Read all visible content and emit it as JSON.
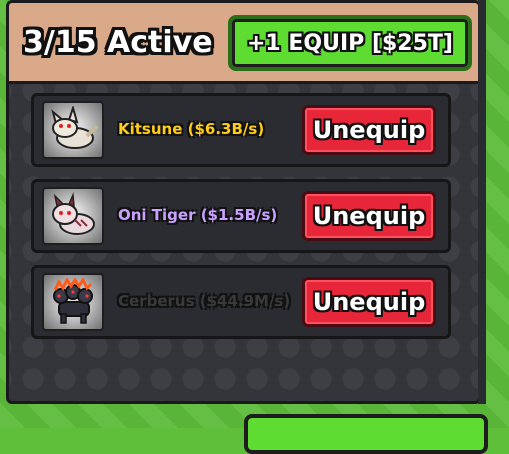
{
  "header": {
    "active_count": "3/15 Active",
    "equip_button_label": "+1 EQUIP [$25T]"
  },
  "pets": [
    {
      "name_label": "Kitsune ($6.3B/s)",
      "name_color": "#ffcc1a",
      "icon": "kitsune-icon",
      "action_label": "Unequip"
    },
    {
      "name_label": "Oni Tiger ($1.5B/s)",
      "name_color": "#c9a2ff",
      "icon": "oni-tiger-icon",
      "action_label": "Unequip"
    },
    {
      "name_label": "Cerberus ($44.9M/s)",
      "name_color": "#3a3a3a",
      "icon": "cerberus-icon",
      "action_label": "Unequip"
    }
  ],
  "colors": {
    "equip_button": "#5fdc32",
    "unequip_button": "#e8263a",
    "header_bg": "#d9a98a",
    "panel_bg": "#34353a"
  }
}
